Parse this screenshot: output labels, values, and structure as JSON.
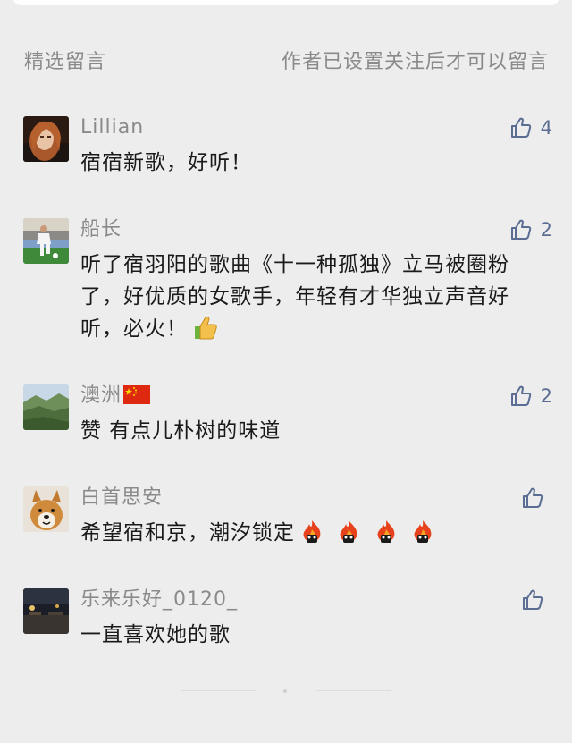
{
  "header": {
    "left_label": "精选留言",
    "right_label": "作者已设置关注后才可以留言"
  },
  "comments": [
    {
      "nickname": "Lillian",
      "text": "宿宿新歌，好听！",
      "likes": "4"
    },
    {
      "nickname": "船长",
      "text": "听了宿羽阳的歌曲《十一种孤独》立马被圈粉了，好优质的女歌手，年轻有才华独立声音好听，必火！",
      "likes": "2"
    },
    {
      "nickname": "澳洲",
      "text": "赞 有点儿朴树的味道",
      "likes": "2"
    },
    {
      "nickname": "白首思安",
      "text": "希望宿和京，潮汐锁定",
      "likes": ""
    },
    {
      "nickname": "乐来乐好_0120_",
      "text": "一直喜欢她的歌",
      "likes": ""
    }
  ],
  "colors": {
    "background": "#ededed",
    "like_icon": "#5b6d92",
    "nickname": "#8a8a8a",
    "text": "#1a1a1a"
  },
  "icons": {
    "like": "thumbs-up-outline-icon",
    "thumbs_up_emoji": "thumbs-up-emoji-icon",
    "flame_emoji": "flame-emoji-icon",
    "flag": "china-flag-icon"
  }
}
